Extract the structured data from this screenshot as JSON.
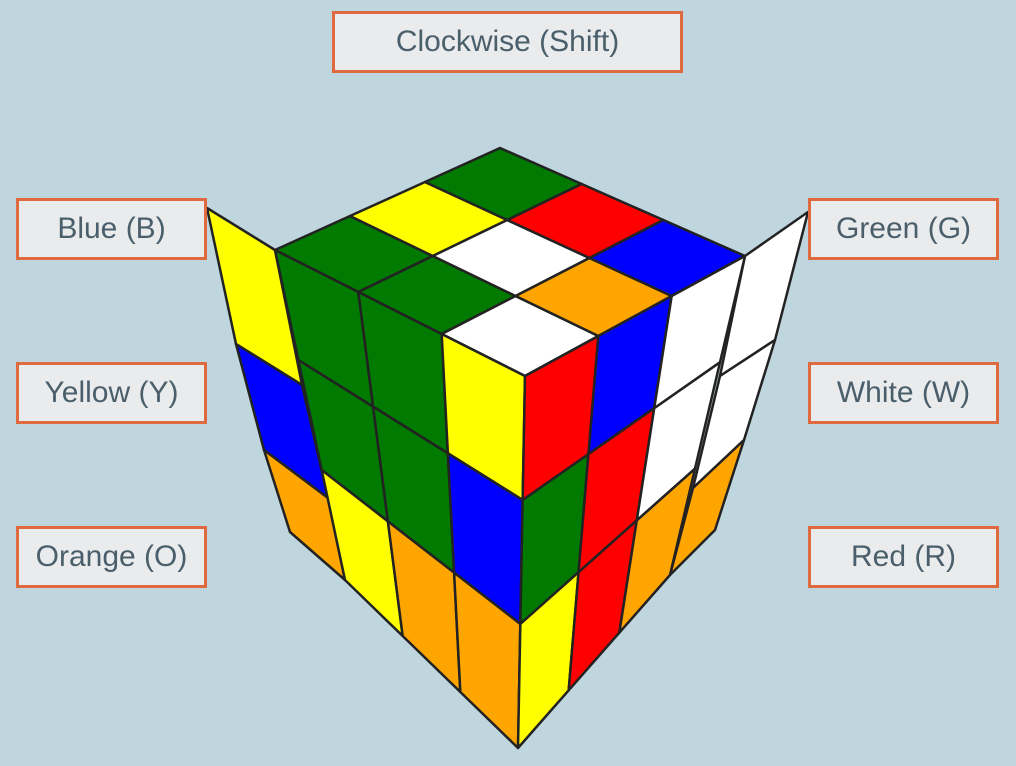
{
  "controls": {
    "clockwise": "Clockwise (Shift)",
    "blue": "Blue (B)",
    "yellow": "Yellow (Y)",
    "orange": "Orange (O)",
    "green": "Green (G)",
    "white": "White (W)",
    "red": "Red (R)"
  },
  "colors": {
    "background": "#c0d6de",
    "button_bg": "#e9ebec",
    "button_border": "#e06a3f",
    "button_text": "#4a5f6b",
    "sticker_outline": "#222222"
  },
  "cube": {
    "palette": {
      "G": "#007a00",
      "Y": "#ffff00",
      "W": "#ffffff",
      "R": "#ff0000",
      "B": "#0000ff",
      "O": "#ffa500"
    },
    "visible_faces": {
      "top": [
        [
          "G",
          "Y",
          "G"
        ],
        [
          "G",
          "W",
          "R"
        ],
        [
          "W",
          "O",
          "B"
        ]
      ],
      "left": [
        [
          "G",
          "G",
          "Y"
        ],
        [
          "G",
          "G",
          "B"
        ],
        [
          "Y",
          "O",
          "O"
        ]
      ],
      "front": [
        [
          "R",
          "B",
          "W"
        ],
        [
          "G",
          "R",
          "W"
        ],
        [
          "Y",
          "R",
          "O"
        ]
      ],
      "back_left_strip": [
        "Y",
        "B",
        "O"
      ],
      "back_right_strip": [
        "W",
        "W",
        "O"
      ]
    }
  }
}
